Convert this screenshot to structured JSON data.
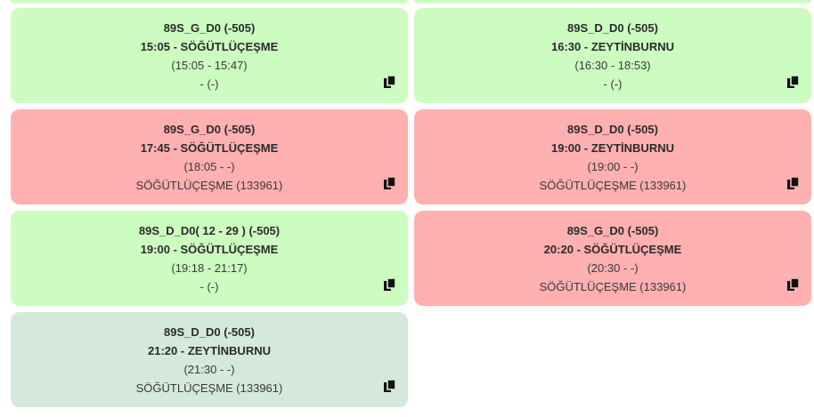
{
  "colors": {
    "green": "#ccfcc0",
    "red": "#ffb0b0",
    "grey": "#d5e8dc",
    "text": "#333333"
  },
  "trips": [
    {
      "line1": "89S_G_D0 (-505)",
      "line2": "15:05 - SÖĞÜTLÜÇEŞME",
      "line3": "(15:05 - 15:47)",
      "line4": "- (-)",
      "status": "green",
      "copy_icon": "copy-icon"
    },
    {
      "line1": "89S_D_D0 (-505)",
      "line2": "16:30 - ZEYTİNBURNU",
      "line3": "(16:30 - 18:53)",
      "line4": "- (-)",
      "status": "green",
      "copy_icon": "copy-icon"
    },
    {
      "line1": "89S_G_D0 (-505)",
      "line2": "17:45 - SÖĞÜTLÜÇEŞME",
      "line3": "(18:05 - -)",
      "line4": "SÖĞÜTLÜÇEŞME (133961)",
      "status": "red",
      "copy_icon": "copy-icon"
    },
    {
      "line1": "89S_D_D0 (-505)",
      "line2": "19:00 - ZEYTİNBURNU",
      "line3": "(19:00 - -)",
      "line4": "SÖĞÜTLÜÇEŞME (133961)",
      "status": "red",
      "copy_icon": "copy-icon"
    },
    {
      "line1": "89S_D_D0( 12 - 29 ) (-505)",
      "line2": "19:00 - SÖĞÜTLÜÇEŞME",
      "line3": "(19:18 - 21:17)",
      "line4": "- (-)",
      "status": "green",
      "copy_icon": "copy-icon"
    },
    {
      "line1": "89S_G_D0 (-505)",
      "line2": "20:20 - SÖĞÜTLÜÇEŞME",
      "line3": "(20:30 - -)",
      "line4": "SÖĞÜTLÜÇEŞME (133961)",
      "status": "red",
      "copy_icon": "copy-icon"
    },
    {
      "line1": "89S_D_D0 (-505)",
      "line2": "21:20 - ZEYTİNBURNU",
      "line3": "(21:30 - -)",
      "line4": "SÖĞÜTLÜÇEŞME (133961)",
      "status": "grey",
      "copy_icon": "copy-icon"
    }
  ]
}
